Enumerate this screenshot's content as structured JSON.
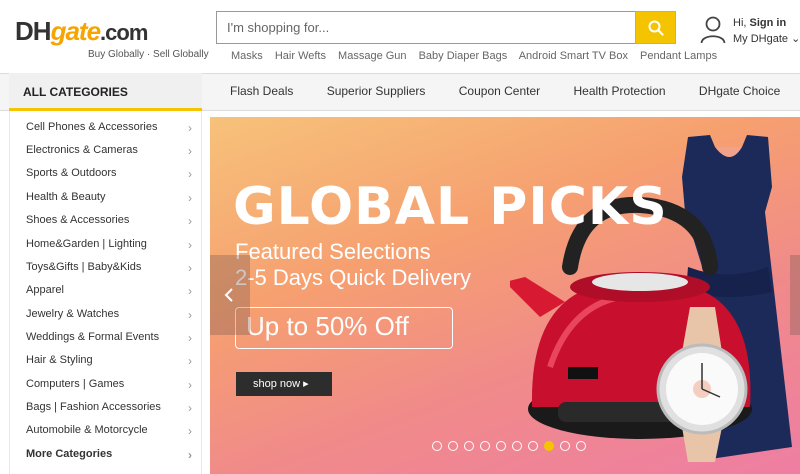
{
  "logo": {
    "dh": "DH",
    "gate": "gate",
    "com": ".com",
    "tagline": "Buy Globally · Sell Globally"
  },
  "search": {
    "placeholder": "I'm shopping for..."
  },
  "hot_searches": [
    "Masks",
    "Hair Wefts",
    "Massage Gun",
    "Baby Diaper Bags",
    "Android Smart TV Box",
    "Pendant Lamps"
  ],
  "account": {
    "greeting": "Hi,",
    "signin": "Sign in",
    "my": "My DHgate"
  },
  "nav": {
    "all_categories": "ALL CATEGORIES",
    "items": [
      "Flash Deals",
      "Superior Suppliers",
      "Coupon Center",
      "Health Protection",
      "DHgate Choice"
    ]
  },
  "categories": [
    "Cell Phones & Accessories",
    "Electronics & Cameras",
    "Sports & Outdoors",
    "Health & Beauty",
    "Shoes & Accessories",
    "Home&Garden  | Lighting",
    "Toys&Gifts  | Baby&Kids",
    "Apparel",
    "Jewelry & Watches",
    "Weddings & Formal Events",
    "Hair & Styling",
    "Computers  | Games",
    "Bags  | Fashion Accessories",
    "Automobile & Motorcycle",
    "More Categories"
  ],
  "banner": {
    "title": "GLOBAL PICKS",
    "sub1": "Featured Selections",
    "sub2": "2-5 Days Quick Delivery",
    "offer": "Up to 50% Off",
    "cta": "shop now",
    "slide_count": 10,
    "active_slide": 7
  },
  "colors": {
    "accent": "#f5c400",
    "brand_gate": "#f5a400",
    "kettle": "#c8102e",
    "dress": "#1c2a5a"
  }
}
